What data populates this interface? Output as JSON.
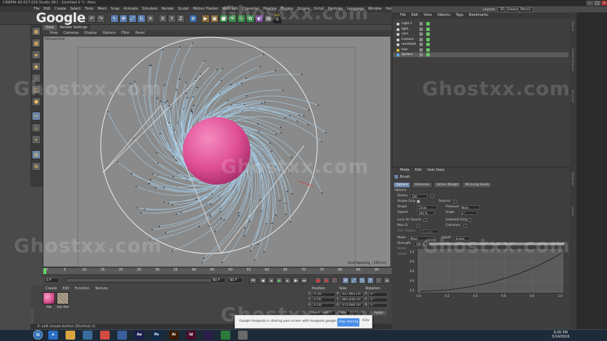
{
  "window": {
    "title": "CINEMA 4D R17.016 Studio (RC) - [Untitled 4 *] - Main",
    "layout_label": "Layout:",
    "layout_value": "3D_Grease_Pencil"
  },
  "branding": {
    "logo": "Google",
    "watermark": "Ghostxx.com"
  },
  "menu": [
    "File",
    "Edit",
    "Create",
    "Select",
    "Tools",
    "Mesh",
    "Snap",
    "Animate",
    "Simulate",
    "Render",
    "Sculpt",
    "Motion Tracker",
    "MoGraph",
    "Character",
    "Pipeline",
    "Plugins",
    "Octane",
    "Script",
    "Particles",
    "Language",
    "Window",
    "Help"
  ],
  "toolbar": {
    "counter": "0",
    "counter_label": "PSR"
  },
  "viewport": {
    "tabs": [
      "View",
      "Render Settings"
    ],
    "menu": [
      "View",
      "Cameras",
      "Display",
      "Options",
      "Filter",
      "Panel"
    ],
    "title": "Perspective",
    "grid_spacing": "Grid Spacing : 100 cm"
  },
  "timeline": {
    "ticks": [
      "0",
      "5",
      "10",
      "15",
      "20",
      "25",
      "30",
      "35",
      "40",
      "45",
      "50",
      "55",
      "60",
      "65",
      "70",
      "75",
      "80",
      "85",
      "90"
    ],
    "start_frame": "0 F",
    "current_frame": "0 F",
    "end_frame": "90 F",
    "end_frame2": "90 F"
  },
  "material_manager": {
    "menu": [
      "Create",
      "Edit",
      "Function",
      "Texture"
    ],
    "materials": [
      {
        "label": "Mat",
        "color": "#d9538f"
      },
      {
        "label": "Hair Mat",
        "color": "#8a8a8a"
      }
    ]
  },
  "coordinates": {
    "headers": [
      "Position",
      "Size",
      "Rotation"
    ],
    "rows": [
      {
        "axis": "X",
        "pos": "0 cm",
        "size": "427.993 cm",
        "rot_axis": "H",
        "rot": "0 °"
      },
      {
        "axis": "Y",
        "pos": "0 cm",
        "size": "865.836 cm",
        "rot_axis": "P",
        "rot": "0 °"
      },
      {
        "axis": "Z",
        "pos": "0 cm",
        "size": "475.699 cm",
        "rot_axis": "B",
        "rot": "0 °"
      }
    ],
    "mode": "Object (Rel)",
    "size_mode": "Size",
    "apply": "Apply"
  },
  "status": "Z: Left mouse button (Shortcut 2)",
  "object_manager": {
    "menu": [
      "File",
      "Edit",
      "View",
      "Objects",
      "Tags",
      "Bookmarks"
    ],
    "objects": [
      {
        "name": "Light.1",
        "color": "#cccccc"
      },
      {
        "name": "light",
        "color": "#cccccc"
      },
      {
        "name": "cam",
        "color": "#cccccc"
      },
      {
        "name": "Camera",
        "color": "#cccccc"
      },
      {
        "name": "ramifalsd",
        "color": "#cccccc"
      },
      {
        "name": "Hair",
        "color": "#e0c040"
      },
      {
        "name": "Sphere",
        "color": "#55aaee"
      }
    ]
  },
  "attribute_manager": {
    "menu": [
      "Mode",
      "Edit",
      "User Data"
    ],
    "title": "Brush",
    "tabs": [
      "Options",
      "Deformer",
      "Vertex Weight",
      "Mirroring Guide"
    ],
    "section": "Options",
    "fields": {
      "radius_label": "Radius",
      "radius": "100",
      "visible_only": "Visible Only",
      "shape_label": "Shape",
      "shape": "Circle",
      "pressure_label": "Pressure",
      "pressure": "None",
      "aspect_label": "Aspect",
      "aspect": "100 %",
      "angle_label": "Angle",
      "angle": "0 °",
      "restrict": "Restrict",
      "lock_on_search": "Lock On Search",
      "selected_only": "Selected Only",
      "max_falloff": "Max Ft.",
      "collisions": "Collisions",
      "coll_radius_label": "Coll. Radius",
      "coll_radius": "0.1 cm",
      "mode_label": "Mode",
      "mode": "Move",
      "falloff_label": "Falloff",
      "falloff": "Linear",
      "strength_label": "Strength",
      "strength": "100 %",
      "width_label": "Width",
      "width": "50 %",
      "falloff2": "Falloff"
    },
    "graph_x_ticks": [
      "0.0",
      "0.2",
      "0.4",
      "0.6",
      "0.8",
      "1.0"
    ],
    "graph_y_ticks": [
      "1.0",
      "0.8",
      "0.6",
      "0.4",
      "0.2"
    ]
  },
  "notification": {
    "message": "Google Hangouts is sharing your screen with hangouts.google.com.",
    "stop": "Stop sharing",
    "hide": "Hide"
  },
  "taskbar": {
    "apps": [
      {
        "icon": "start-icon",
        "label": ""
      },
      {
        "icon": "ie-icon",
        "label": "e",
        "color": "#2a6fc4"
      },
      {
        "icon": "explorer-icon",
        "label": "",
        "color": "#d9a640"
      },
      {
        "icon": "media-icon",
        "label": "",
        "color": "#3a6c9a"
      },
      {
        "icon": "chrome-icon",
        "label": "",
        "color": "#d24b3e"
      },
      {
        "icon": "cinema4d-icon",
        "label": "",
        "color": "#3a5f9a"
      },
      {
        "icon": "ae-icon",
        "label": "Ae",
        "color": "#1e1e4d"
      },
      {
        "icon": "ps-icon",
        "label": "Ps",
        "color": "#0f2a4a"
      },
      {
        "icon": "ai-icon",
        "label": "Ai",
        "color": "#3a1c05"
      },
      {
        "icon": "id-icon",
        "label": "Id",
        "color": "#4a0d2a"
      },
      {
        "icon": "pr-icon",
        "label": "",
        "color": "#2a1d4a"
      },
      {
        "icon": "camtasia-icon",
        "label": "",
        "color": "#2b7a3a"
      },
      {
        "icon": "hangouts-icon",
        "label": "",
        "color": "#6a6a6a"
      }
    ],
    "time": "6:05 PM",
    "date": "5/14/2016"
  }
}
